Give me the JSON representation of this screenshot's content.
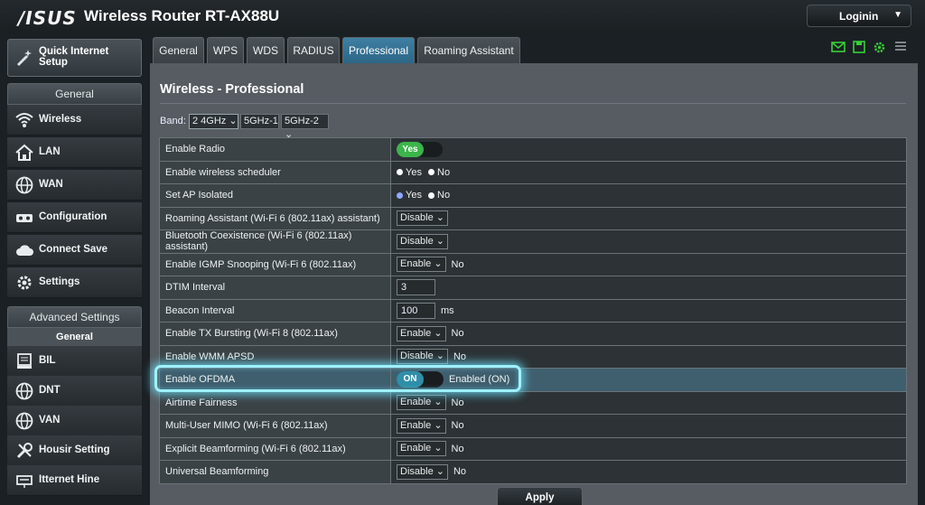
{
  "header": {
    "brand": "/ISUS",
    "model": "Wireless Router RT-AX88U",
    "login_label": "Loginin"
  },
  "sidebar": {
    "quick_setup": "Quick Internet Setup",
    "general_header": "General",
    "general_items": [
      {
        "label": "Wireless",
        "icon": "wifi-icon"
      },
      {
        "label": "LAN",
        "icon": "home-icon"
      },
      {
        "label": "WAN",
        "icon": "globe-icon"
      },
      {
        "label": "Configuration",
        "icon": "config-icon"
      },
      {
        "label": "Connect Save",
        "icon": "cloud-icon"
      },
      {
        "label": "Settings",
        "icon": "gear-icon"
      }
    ],
    "advanced_header": "Advanced Settings",
    "advanced_sub": "General",
    "advanced_items": [
      {
        "label": "BIL",
        "icon": "monitor-icon"
      },
      {
        "label": "DNT",
        "icon": "globe-icon"
      },
      {
        "label": "VAN",
        "icon": "globe-icon"
      },
      {
        "label": "Housir Setting",
        "icon": "tools-icon"
      },
      {
        "label": "Itternet Hine",
        "icon": "network-icon"
      }
    ]
  },
  "tabs": [
    "General",
    "WPS",
    "WDS",
    "RADIUS",
    "Professional",
    "Roaming Assistant"
  ],
  "active_tab": "Professional",
  "page": {
    "title": "Wireless - Professional",
    "band_label": "Band:",
    "bands": [
      "2 4GHz",
      "5GHz-1",
      "5GHz-2"
    ]
  },
  "rows": [
    {
      "label": "Enable Radio",
      "toggle": "Yes"
    },
    {
      "label": "Enable wireless scheduler",
      "radio_yes": "Yes",
      "radio_no": "No"
    },
    {
      "label": "Set AP Isolated",
      "radio_yes": "Yes",
      "radio_no": "No"
    },
    {
      "label": "Roaming Assistant (Wi-Fi 6 (802.11ax) assistant)",
      "select": "Disable"
    },
    {
      "label": "Bluetooth Coexistence (Wi-Fi 6 (802.11ax) assistant)",
      "select": "Disable"
    },
    {
      "label": "Enable IGMP Snooping (Wi-Fi 6 (802.11ax)",
      "select": "Enable",
      "note": "No"
    },
    {
      "label": "DTIM Interval",
      "input": "3"
    },
    {
      "label": "Beacon Interval",
      "input": "100",
      "note": "ms"
    },
    {
      "label": "Enable TX Bursting (Wi-Fi 8 (802.11ax)",
      "select": "Enable",
      "note": "No"
    },
    {
      "label": "Enable WMM APSD",
      "select": "Disable",
      "note": "No"
    },
    {
      "label": "Enable OFDMA",
      "toggle": "ON",
      "note": "Enabled (ON)"
    },
    {
      "label": "Airtime Fairness",
      "select": "Enable",
      "note": "No"
    },
    {
      "label": "Multi-User MIMO (Wi-Fi 6 (802.11ax)",
      "select": "Enable",
      "note": "No"
    },
    {
      "label": "Explicit Beamforming (Wi-Fi 6 (802.11ax)",
      "select": "Enable",
      "note": "No"
    },
    {
      "label": "Universal Beamforming",
      "select": "Disable",
      "note": "No"
    }
  ],
  "apply_label": "Apply",
  "colors": {
    "accent": "#2c6585",
    "toggle_green": "#3cb54a",
    "highlight_glow": "#9ef2ff"
  }
}
